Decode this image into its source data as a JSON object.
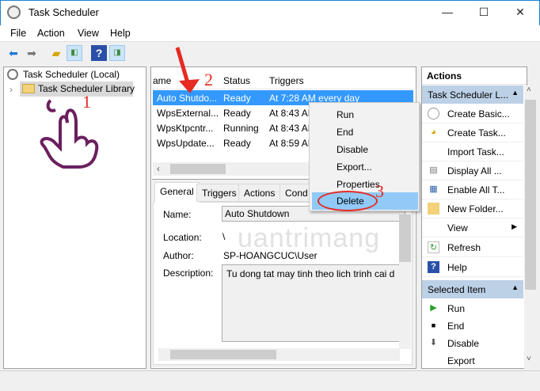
{
  "window": {
    "title": "Task Scheduler",
    "minimize": "—",
    "maximize": "☐",
    "close": "✕"
  },
  "menu": [
    "File",
    "Action",
    "View",
    "Help"
  ],
  "tree": {
    "root": "Task Scheduler (Local)",
    "child": "Task Scheduler Library"
  },
  "list": {
    "columns": [
      "ame",
      "Status",
      "Triggers"
    ],
    "rows": [
      {
        "name": "Auto Shutdo...",
        "status": "Ready",
        "trigger": "At 7:28 AM every day"
      },
      {
        "name": "WpsExternal...",
        "status": "Ready",
        "trigger": "At 8:43 AM"
      },
      {
        "name": "WpsKtpcntr...",
        "status": "Running",
        "trigger": "At 8:43 AM"
      },
      {
        "name": "WpsUpdate...",
        "status": "Ready",
        "trigger": "At 8:59 AM"
      }
    ]
  },
  "tabs": [
    "General",
    "Triggers",
    "Actions",
    "Cond"
  ],
  "details": {
    "name_label": "Name:",
    "name": "Auto Shutdown",
    "location_label": "Location:",
    "location": "\\",
    "author_label": "Author:",
    "author": "SP-HOANGCUC\\User",
    "description_label": "Description:",
    "description": "Tu dong tat may tinh theo lich trinh cai d"
  },
  "context_menu": [
    "Run",
    "End",
    "Disable",
    "Export...",
    "Properties",
    "Delete"
  ],
  "actions": {
    "title": "Actions",
    "group1": "Task Scheduler L...",
    "group1_items": [
      "Create Basic...",
      "Create Task...",
      "Import Task...",
      "Display All ...",
      "Enable All T...",
      "New Folder...",
      "View",
      "Refresh",
      "Help"
    ],
    "group2": "Selected Item",
    "group2_items": [
      "Run",
      "End",
      "Disable",
      "Export"
    ]
  },
  "annotations": {
    "step1": "1",
    "step2": "2",
    "step3": "3"
  },
  "watermark": "uantrimang",
  "colors": {
    "selection": "#3399ff",
    "highlight": "#91c9f7",
    "annotation": "#e52b22",
    "group_header": "#bcd0e6"
  }
}
